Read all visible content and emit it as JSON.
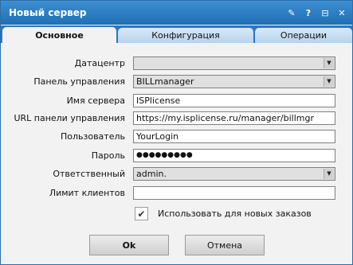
{
  "window": {
    "title": "Новый сервер"
  },
  "titlebar_icons": [
    "pin-icon",
    "help-icon",
    "maximize-icon",
    "close-icon"
  ],
  "titlebar_glyphs": {
    "pin": "✎",
    "help": "?",
    "maximize": "⊟",
    "close": "✕"
  },
  "tabs": [
    {
      "label": "Основное",
      "active": true
    },
    {
      "label": "Конфигурация",
      "active": false
    },
    {
      "label": "Операции",
      "active": false
    }
  ],
  "form": {
    "datacenter": {
      "label": "Датацентр",
      "value": ""
    },
    "panel": {
      "label": "Панель управления",
      "value": "BILLmanager"
    },
    "server_name": {
      "label": "Имя сервера",
      "value": "ISPlicense"
    },
    "panel_url": {
      "label": "URL панели управления",
      "value": "https://my.isplicense.ru/manager/billmgr"
    },
    "user": {
      "label": "Пользователь",
      "value": "YourLogin"
    },
    "password": {
      "label": "Пароль",
      "value": "●●●●●●●●●"
    },
    "responsible": {
      "label": "Ответственный",
      "value": "admin."
    },
    "client_limit": {
      "label": "Лимит клиентов",
      "value": ""
    },
    "use_for_new_orders": {
      "label": "Использовать для новых заказов",
      "checked": true
    }
  },
  "buttons": {
    "ok": "Ok",
    "cancel": "Отмена"
  }
}
